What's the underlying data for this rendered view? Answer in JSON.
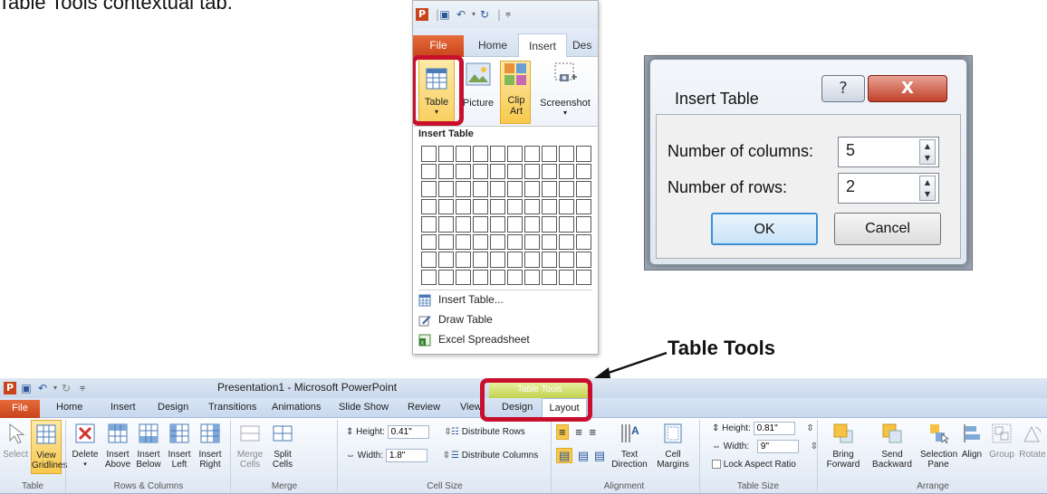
{
  "intro_text": "Table Tools contextual tab.",
  "mini_ribbon": {
    "tabs": [
      "File",
      "Home",
      "Insert",
      "Des"
    ],
    "active_tab": "Insert",
    "buttons": [
      {
        "label": "Table"
      },
      {
        "label": "Picture"
      },
      {
        "label": "Clip Art"
      },
      {
        "label": "Screenshot"
      }
    ],
    "dropdown": {
      "title": "Insert Table",
      "grid_cols": 10,
      "grid_rows": 8,
      "items": [
        "Insert Table...",
        "Draw Table",
        "Excel Spreadsheet"
      ]
    }
  },
  "dialog": {
    "title": "Insert Table",
    "help_glyph": "?",
    "close_glyph": "X",
    "columns_label": "Number of columns:",
    "columns_value": "5",
    "rows_label": "Number of rows:",
    "rows_value": "2",
    "ok_label": "OK",
    "cancel_label": "Cancel"
  },
  "callout_label": "Table Tools",
  "ribbon": {
    "title": "Presentation1  -  Microsoft PowerPoint",
    "contextual_title": "Table Tools",
    "tabs": [
      "File",
      "Home",
      "Insert",
      "Design",
      "Transitions",
      "Animations",
      "Slide Show",
      "Review",
      "View",
      "Design",
      "Layout"
    ],
    "active_tab": "Layout",
    "groups": {
      "table": {
        "label": "Table",
        "select": "Select",
        "view_gridlines": "View Gridlines"
      },
      "rows_columns": {
        "label": "Rows & Columns",
        "delete": "Delete",
        "insert_above": "Insert Above",
        "insert_below": "Insert Below",
        "insert_left": "Insert Left",
        "insert_right": "Insert Right"
      },
      "merge": {
        "label": "Merge",
        "merge_cells": "Merge Cells",
        "split_cells": "Split Cells"
      },
      "cell_size": {
        "label": "Cell Size",
        "height_label": "Height:",
        "height_value": "0.41\"",
        "width_label": "Width:",
        "width_value": "1.8\"",
        "distribute_rows": "Distribute Rows",
        "distribute_columns": "Distribute Columns"
      },
      "alignment": {
        "label": "Alignment",
        "text_direction": "Text Direction",
        "cell_margins": "Cell Margins"
      },
      "table_size": {
        "label": "Table Size",
        "height_label": "Height:",
        "height_value": "0.81\"",
        "width_label": "Width:",
        "width_value": "9\"",
        "lock_aspect": "Lock Aspect Ratio"
      },
      "arrange": {
        "label": "Arrange",
        "bring_forward": "Bring Forward",
        "send_backward": "Send Backward",
        "selection_pane": "Selection Pane",
        "align": "Align",
        "group": "Group",
        "rotate": "Rotate"
      }
    }
  },
  "colors": {
    "highlight_red": "#c8102e",
    "file_tab": "#d04a1e",
    "ribbon_blue": "#dbe6f4",
    "contextual_green": "#c2d24e"
  }
}
